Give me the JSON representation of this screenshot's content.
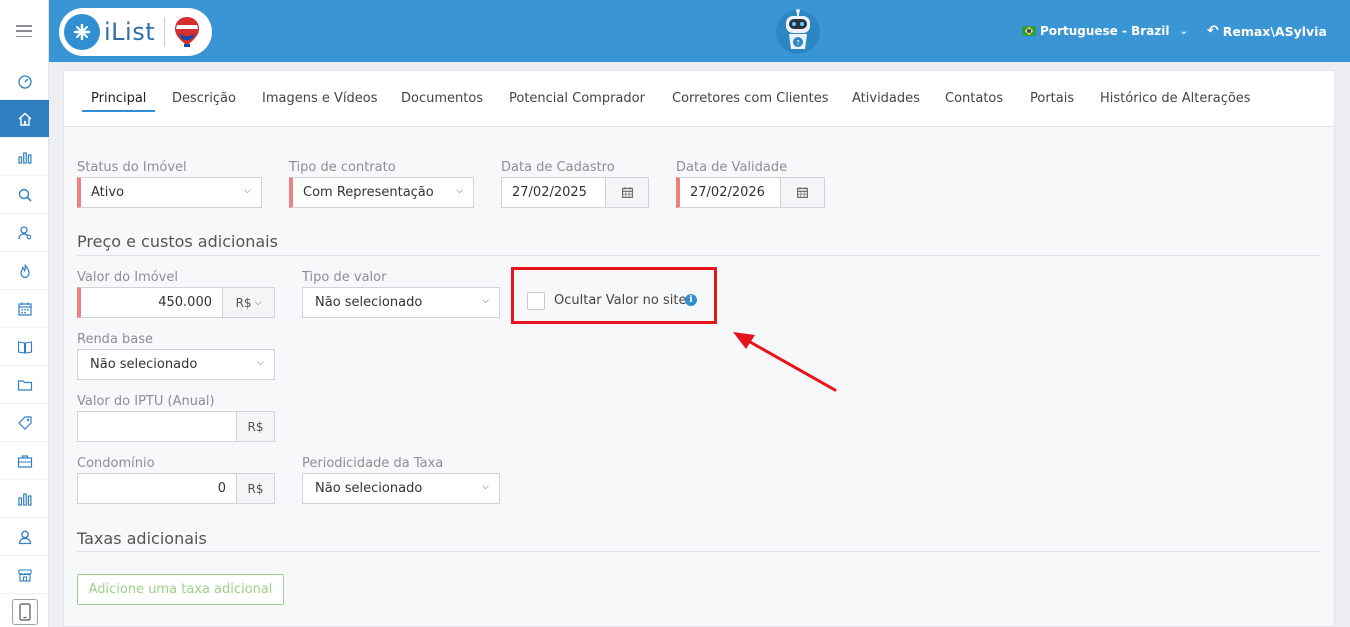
{
  "app": {
    "logo_text": "iList",
    "language": "Portuguese - Brazil",
    "user": "Remax\\ASylvia"
  },
  "colors": {
    "topbar": "#3a95d4",
    "accent": "#2f8fd1",
    "required": "#f08080",
    "highlight": "#e8141c",
    "add_button": "#9bd08b"
  },
  "sidebar": {
    "items": [
      {
        "icon": "dashboard-icon"
      },
      {
        "icon": "home-icon",
        "active": true
      },
      {
        "icon": "bar-chart-icon"
      },
      {
        "icon": "search-icon"
      },
      {
        "icon": "user-search-icon"
      },
      {
        "icon": "fire-icon"
      },
      {
        "icon": "calendar-icon"
      },
      {
        "icon": "book-icon"
      },
      {
        "icon": "folder-icon"
      },
      {
        "icon": "tag-icon"
      },
      {
        "icon": "briefcase-icon"
      },
      {
        "icon": "reports-icon"
      },
      {
        "icon": "user-icon"
      },
      {
        "icon": "store-icon"
      }
    ],
    "bottom_icon": "mobile-phone-icon"
  },
  "tabs": [
    {
      "label": "Principal",
      "active": true
    },
    {
      "label": "Descrição"
    },
    {
      "label": "Imagens e Vídeos"
    },
    {
      "label": "Documentos"
    },
    {
      "label": "Potencial Comprador"
    },
    {
      "label": "Corretores com Clientes"
    },
    {
      "label": "Atividades"
    },
    {
      "label": "Contatos"
    },
    {
      "label": "Portais"
    },
    {
      "label": "Histórico de Alterações"
    }
  ],
  "form": {
    "status": {
      "label": "Status do Imóvel",
      "value": "Ativo"
    },
    "contract": {
      "label": "Tipo de contrato",
      "value": "Com Representação"
    },
    "registration_date": {
      "label": "Data de Cadastro",
      "value": "27/02/2025"
    },
    "validity_date": {
      "label": "Data de Validade",
      "value": "27/02/2026"
    },
    "price_section_title": "Preço e custos adicionais",
    "property_value": {
      "label": "Valor do Imóvel",
      "value": "450.000",
      "currency": "R$"
    },
    "value_type": {
      "label": "Tipo de valor",
      "value": "Não selecionado"
    },
    "hide_value": {
      "label": "Ocultar Valor no site",
      "checked": false
    },
    "base_income": {
      "label": "Renda base",
      "value": "Não selecionado"
    },
    "iptu": {
      "label": "Valor do IPTU (Anual)",
      "value": "",
      "currency": "R$"
    },
    "condo": {
      "label": "Condomínio",
      "value": "0",
      "currency": "R$"
    },
    "fee_frequency": {
      "label": "Periodicidade da Taxa",
      "value": "Não selecionado"
    },
    "fees_section_title": "Taxas adicionais",
    "add_fee_button": "Adicione uma taxa adicional"
  }
}
